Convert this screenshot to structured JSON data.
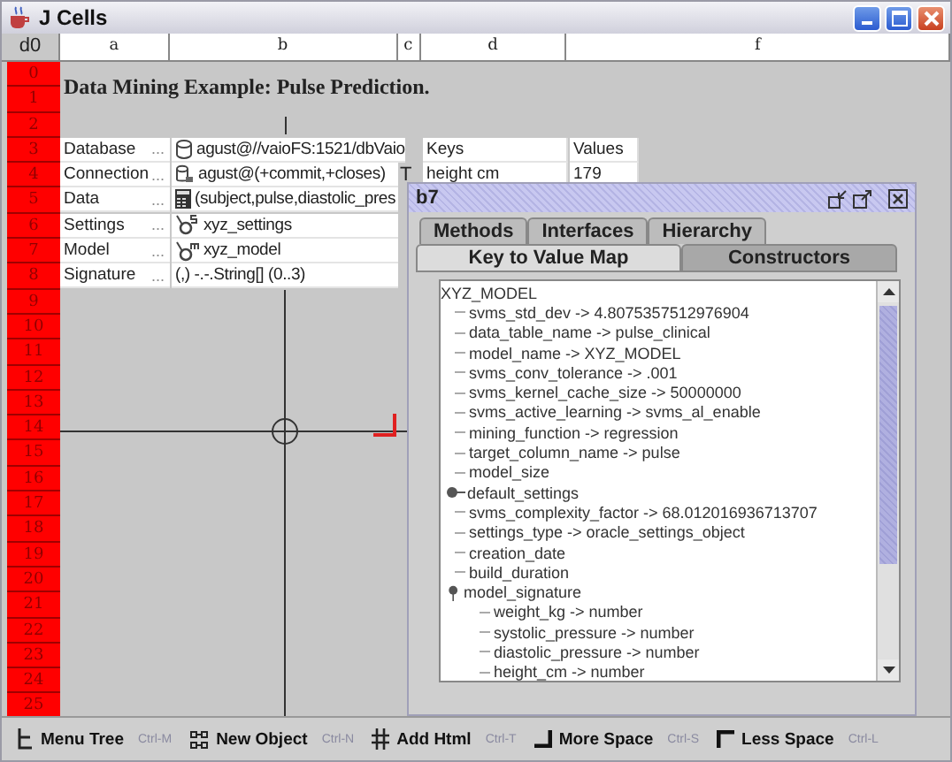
{
  "window": {
    "title": "J Cells"
  },
  "grid": {
    "corner": "d0",
    "columns": [
      "a",
      "b",
      "c",
      "d",
      "f"
    ],
    "rows": [
      {
        "number": "0"
      },
      {
        "number": "1",
        "title": "Data Mining Example: Pulse Prediction."
      },
      {
        "number": "2"
      },
      {
        "number": "3",
        "label": "Database",
        "more": "...",
        "value": "agust@//vaioFS:1521/dbVaio",
        "kind": "database",
        "key": "Keys",
        "val": "Values"
      },
      {
        "number": "4",
        "label": "Connection",
        "more": "...",
        "value": "agust@(+commit,+closes)",
        "kind": "connection",
        "c": "T",
        "key": "height cm",
        "val": "179"
      },
      {
        "number": "5",
        "label": "Data",
        "more": "...",
        "value": "(subject,pulse,diastolic_pres",
        "kind": "table"
      },
      {
        "number": "6",
        "label": "Settings",
        "more": "...",
        "value": "xyz_settings",
        "kind": "settings"
      },
      {
        "number": "7",
        "label": "Model",
        "more": "...",
        "value": "xyz_model",
        "kind": "model"
      },
      {
        "number": "8",
        "label": "Signature",
        "more": "...",
        "value": "(,) -.-.String[] (0..3)"
      },
      {
        "number": "9"
      },
      {
        "number": "10"
      },
      {
        "number": "11"
      },
      {
        "number": "12"
      },
      {
        "number": "13"
      },
      {
        "number": "14"
      },
      {
        "number": "15"
      },
      {
        "number": "16"
      },
      {
        "number": "17"
      },
      {
        "number": "18"
      },
      {
        "number": "19"
      },
      {
        "number": "20"
      },
      {
        "number": "21"
      },
      {
        "number": "22"
      },
      {
        "number": "23"
      },
      {
        "number": "24"
      },
      {
        "number": "25"
      }
    ]
  },
  "inspector": {
    "title": "b7",
    "tabs": [
      {
        "label": "Methods",
        "selected": false
      },
      {
        "label": "Interfaces",
        "selected": false
      },
      {
        "label": "Hierarchy",
        "selected": false
      }
    ],
    "tabs_row_2": [
      {
        "label": "Key to Value Map",
        "selected": true
      },
      {
        "label": "Constructors",
        "selected": false
      }
    ],
    "tree": {
      "label": "XYZ_MODEL",
      "children": [
        {
          "label": "svms_std_dev -> 4.8075357512976904"
        },
        {
          "label": "data_table_name -> pulse_clinical"
        },
        {
          "label": "model_name -> XYZ_MODEL"
        },
        {
          "label": "svms_conv_tolerance -> .001"
        },
        {
          "label": "svms_kernel_cache_size -> 50000000"
        },
        {
          "label": "svms_active_learning -> svms_al_enable"
        },
        {
          "label": "mining_function -> regression"
        },
        {
          "label": "target_column_name -> pulse"
        },
        {
          "label": "model_size"
        },
        {
          "label": "default_settings",
          "expanded": false
        },
        {
          "label": "svms_complexity_factor -> 68.012016936713707"
        },
        {
          "label": "settings_type -> oracle_settings_object"
        },
        {
          "label": "creation_date"
        },
        {
          "label": "build_duration"
        },
        {
          "label": "model_signature",
          "expanded": true,
          "children": [
            {
              "label": "weight_kg -> number"
            },
            {
              "label": "systolic_pressure -> number"
            },
            {
              "label": "diastolic_pressure -> number"
            },
            {
              "label": "height_cm -> number"
            }
          ]
        }
      ]
    }
  },
  "toolbar": [
    {
      "kind": "tree",
      "label": "Menu Tree",
      "shortcut": "Ctrl-M"
    },
    {
      "kind": "object",
      "label": "New Object",
      "shortcut": "Ctrl-N"
    },
    {
      "kind": "html",
      "label": "Add Html",
      "shortcut": "Ctrl-T"
    },
    {
      "kind": "more",
      "label": "More Space",
      "shortcut": "Ctrl-S"
    },
    {
      "kind": "less",
      "label": "Less Space",
      "shortcut": "Ctrl-L"
    }
  ]
}
